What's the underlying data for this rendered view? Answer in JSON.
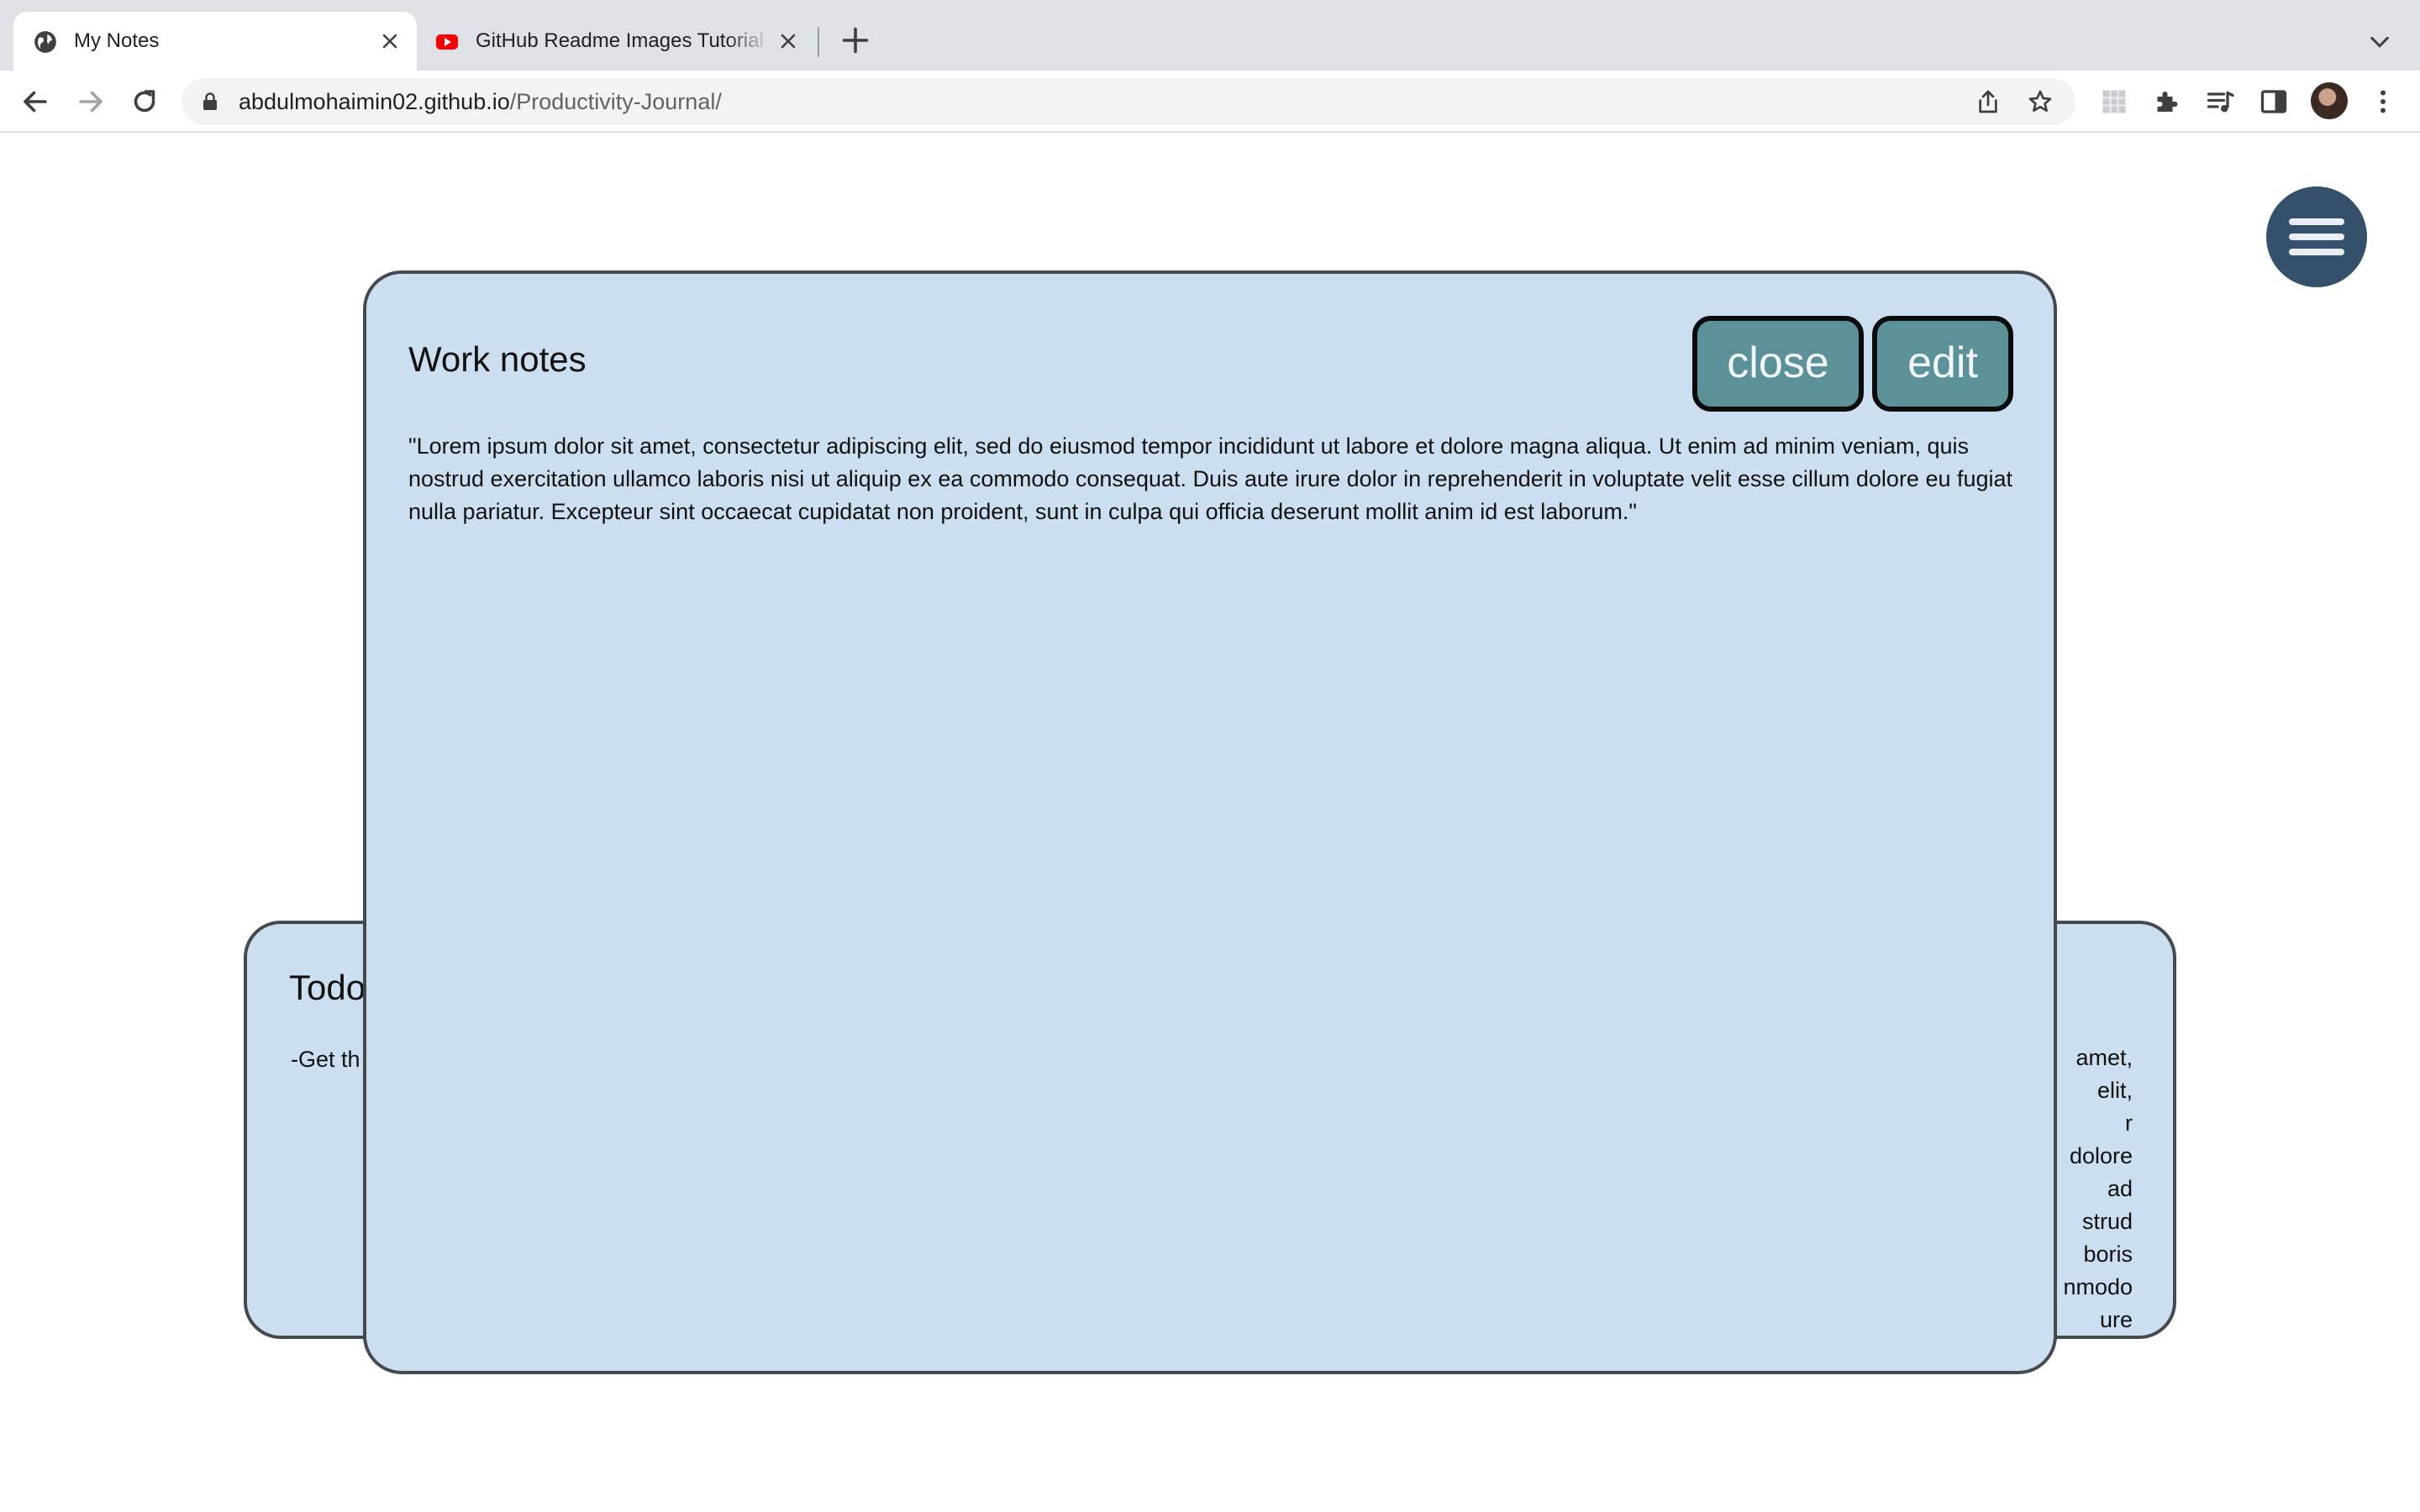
{
  "browser": {
    "tabs": [
      {
        "title": "My Notes",
        "favicon": "globe-icon",
        "active": true
      },
      {
        "title": "GitHub Readme Images Tutorial",
        "favicon": "youtube-icon",
        "active": false
      }
    ],
    "url": {
      "host": "abdulmohaimin02.github.io",
      "path": "/Productivity-Journal/"
    }
  },
  "page": {
    "modal": {
      "title": "Work notes",
      "close_label": "close",
      "edit_label": "edit",
      "body": "\"Lorem ipsum dolor sit amet, consectetur adipiscing elit, sed do eiusmod tempor incididunt ut labore et dolore magna aliqua. Ut enim ad minim veniam, quis nostrud exercitation ullamco laboris nisi ut aliquip ex ea commodo consequat. Duis aute irure dolor in reprehenderit in voluptate velit esse cillum dolore eu fugiat nulla pariatur. Excepteur sint occaecat cupidatat non proident, sunt in culpa qui officia deserunt mollit anim id est laborum.\""
    },
    "back_card_left": {
      "title": "Todo",
      "body": "-Get th"
    },
    "back_card_right": {
      "lines": [
        "amet,",
        "elit,",
        "r",
        "dolore",
        "ad",
        "strud",
        "boris",
        "nmodo",
        "ure"
      ]
    }
  },
  "colors": {
    "card_bg": "#cbdff0",
    "button_bg": "#5b9199",
    "menu_button_bg": "#34506a"
  }
}
